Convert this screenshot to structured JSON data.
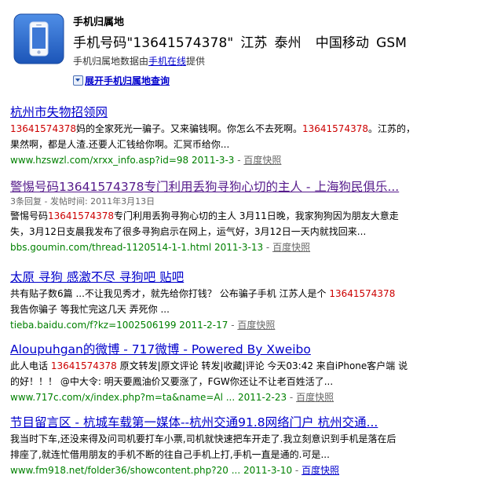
{
  "card": {
    "title": "手机归属地",
    "main": {
      "prefix": "手机号码\"13641574378\"",
      "province": "江苏",
      "city": "泰州",
      "carrier": "中国移动",
      "network": "GSM"
    },
    "source_pre": "手机归属地数据由",
    "source_link": "手机在线",
    "source_post": "提供",
    "expand_label": "展开手机归属地查询"
  },
  "results": [
    {
      "title_parts": [
        "杭州市失物招领网"
      ],
      "abstract_lines": [
        [
          "13641574378",
          "妈的全家死光一骗子。又来骗钱啊。你怎么不去死啊。",
          "13641574378",
          "。江苏的，"
        ],
        [
          "果然啊，都是人渣.还要人汇钱给你啊。汇冥币给你..."
        ]
      ],
      "url": "www.hzswzl.com/xrxx_info.asp?id=98 2011-3-3",
      "snapshot": "百度快照"
    },
    {
      "title_parts": [
        "警惕号码",
        "13641574378",
        "专门利用丢狗寻狗心切的主人 - 上海狗民俱乐..."
      ],
      "meta": "3条回复 - 发帖时间: 2011年3月13日",
      "abstract_lines": [
        [
          "警惕号码",
          "13641574378",
          "专门利用丢狗寻狗心切的主人  3月11日晚，我家狗狗因为朋友大意走"
        ],
        [
          "失，3月12日支晨我发布了很多寻狗启示在网上，运气好，3月12日一天内就找回来..."
        ]
      ],
      "url": "bbs.goumin.com/thread-1120514-1-1.html 2011-3-13",
      "snapshot": "百度快照"
    },
    {
      "title_parts": [
        "太原 寻狗 感激不尽 寻狗吧 贴吧"
      ],
      "abstract_lines": [
        [
          "共有贴子数6篇  ...不让我见秀才，就先给你打钱？  公布骗子手机  江苏人是个 ",
          "13641574378",
          ""
        ],
        [
          "我告你骗子  等我忙完这几天  弄死你  ..."
        ]
      ],
      "url": "tieba.baidu.com/f?kz=1002506199 2011-2-17",
      "snapshot": "百度快照"
    },
    {
      "title_parts": [
        "Aloupuhgan的微博 - 717微博 - Powered By Xweibo"
      ],
      "abstract_lines": [
        [
          "此人电话  ",
          "13641574378",
          " 原文转发|原文评论  转发|收藏|评论  今天03:42 来自iPhone客户端  说"
        ],
        [
          "的好！！！  @中大令: 明天要鳳油价又要涨了，FGW你还让不让老百姓活了..."
        ]
      ],
      "url": "www.717c.com/x/index.php?m=ta&name=Al ... 2011-2-23",
      "snapshot": "百度快照"
    },
    {
      "title_parts": [
        "节目留言区 - 杭城车载第一媒体--杭州交通91.8网络门户  杭州交通..."
      ],
      "abstract_lines": [
        [
          "我当时下车,还没来得及问司机要打车小票,司机就快速把车开走了.我立刻意识到手机是落在后"
        ],
        [
          "排座了,就连忙借用朋友的手机不断的往自己手机上打,手机一直是通的.可是..."
        ]
      ],
      "url": "www.fm918.net/folder36/showcontent.php?20 ... 2011-3-10",
      "snapshot": "百度快照"
    }
  ]
}
